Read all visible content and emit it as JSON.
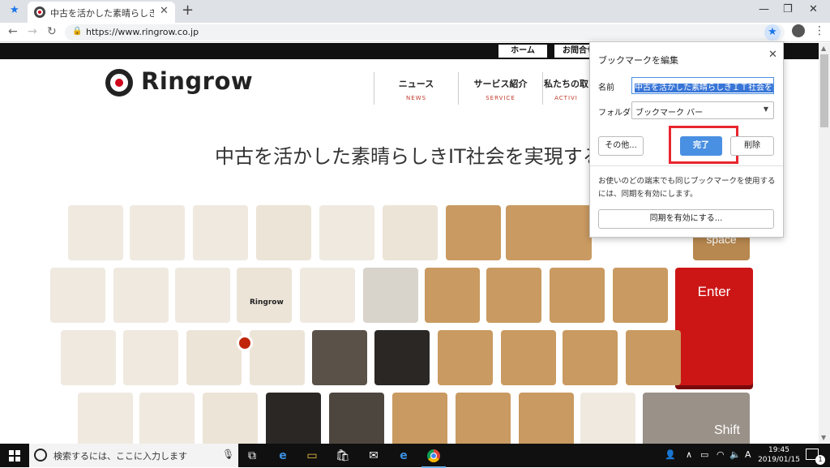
{
  "browser": {
    "tab_title": "中古を活かした素晴らしきＩＴ社会を",
    "url": "https://www.ringrow.co.jp",
    "new_tab": "+",
    "minimize": "—",
    "maximize": "❐",
    "close": "✕"
  },
  "site": {
    "top_buttons": [
      "ホーム",
      "お問合せ"
    ],
    "logo_text": "Ringrow",
    "nav": [
      {
        "jp": "ニュース",
        "en": "NEWS"
      },
      {
        "jp": "サービス紹介",
        "en": "SERVICE"
      },
      {
        "jp": "私たちの取",
        "en": "ACTIVI"
      }
    ],
    "hero": "中古を活かした素晴らしきIT社会を実現する",
    "keys": {
      "enter": "Enter",
      "space": "space",
      "shift": "Shift",
      "photo_logo": "Ringrow"
    }
  },
  "bookmark_bubble": {
    "title": "ブックマークを編集",
    "name_label": "名前",
    "name_value": "中古を活かした素晴らしきＩＴ社会を実現する",
    "folder_label": "フォルダ",
    "folder_value": "ブックマーク バー",
    "more_button": "その他...",
    "done_button": "完了",
    "delete_button": "削除",
    "sync_text": "お使いのどの端末でも同じブックマークを使用するには、同期を有効にします。",
    "sync_button": "同期を有効にする..."
  },
  "taskbar": {
    "search_placeholder": "検索するには、ここに入力します",
    "time": "19:45",
    "date": "2019/01/15",
    "ime": "A",
    "notification_count": "1"
  },
  "colors": {
    "enter_key": "#cc1616",
    "done_button": "#4a90e2",
    "highlight_box": "#e8262e"
  }
}
